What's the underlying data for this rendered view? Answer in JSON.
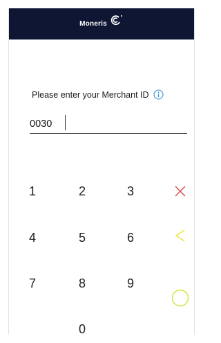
{
  "header": {
    "brand": "Moneris"
  },
  "form": {
    "prompt": "Please enter your Merchant ID",
    "merchant_id_value": "0030"
  },
  "keypad": {
    "keys": [
      "1",
      "2",
      "3",
      "4",
      "5",
      "6",
      "7",
      "8",
      "9",
      "0"
    ]
  },
  "colors": {
    "header_bg": "#0e1633",
    "info_icon": "#3b8fd9",
    "cancel": "#d94a4a",
    "backspace": "#f2e23a",
    "ok": "#d4e23a"
  },
  "icons": {
    "info": "info-icon",
    "cancel": "close-icon",
    "backspace": "chevron-left-icon",
    "ok": "circle-icon"
  }
}
